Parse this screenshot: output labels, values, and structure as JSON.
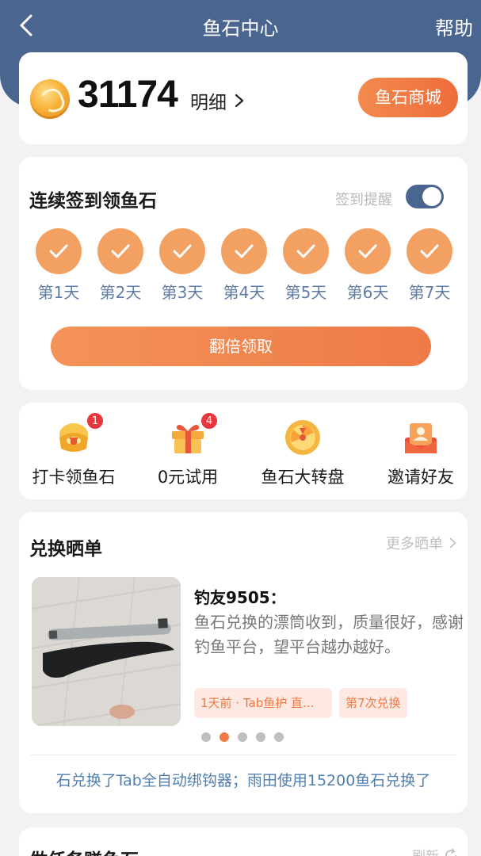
{
  "nav": {
    "back_icon": "chevron-left-icon",
    "title": "鱼石中心",
    "help": "帮助"
  },
  "balance": {
    "coin_icon": "fish-stone-coin-icon",
    "value": "31174",
    "detail_label": "明细",
    "mall_button": "鱼石商城"
  },
  "checkin": {
    "title": "连续签到领鱼石",
    "remind_label": "签到提醒",
    "remind_on": true,
    "days": [
      {
        "label": "第1天",
        "checked": true
      },
      {
        "label": "第2天",
        "checked": true
      },
      {
        "label": "第3天",
        "checked": true
      },
      {
        "label": "第4天",
        "checked": true
      },
      {
        "label": "第5天",
        "checked": true
      },
      {
        "label": "第6天",
        "checked": true
      },
      {
        "label": "第7天",
        "checked": true
      }
    ],
    "double_button": "翻倍领取"
  },
  "entries": [
    {
      "label": "打卡领鱼石",
      "icon": "treasure-chest-icon",
      "badge": "1"
    },
    {
      "label": "0元试用",
      "icon": "gift-box-icon",
      "badge": "4"
    },
    {
      "label": "鱼石大转盘",
      "icon": "lucky-wheel-icon",
      "badge": ""
    },
    {
      "label": "邀请好友",
      "icon": "invite-card-icon",
      "badge": ""
    }
  ],
  "showcase": {
    "title": "兑换晒单",
    "more_label": "更多晒单",
    "review": {
      "user": "钓友9505：",
      "text": "鱼石兑换的漂筒收到，质量很好，感谢钓鱼平台，望平台越办越好。",
      "tag_time": "1天前 · Tab鱼护 直...",
      "tag_count": "第7次兑换"
    },
    "carousel_count": 5,
    "carousel_active": 1,
    "ticker": "石兑换了Tab全自动绑钩器；雨田使用15200鱼石兑换了"
  },
  "tasks": {
    "title": "做任务赚鱼石",
    "refresh_label": "刷新"
  },
  "colors": {
    "header": "#4a6590",
    "accent": "#ee7a47",
    "day_label": "#5f7ca6",
    "link": "#4f7fb0"
  }
}
